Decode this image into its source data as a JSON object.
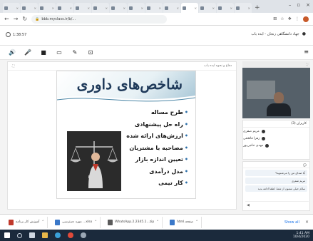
{
  "browser": {
    "tabs": [
      {
        "title": "",
        "active": false
      },
      {
        "title": "",
        "active": false
      },
      {
        "title": "",
        "active": false
      },
      {
        "title": "",
        "active": false
      },
      {
        "title": "",
        "active": false
      },
      {
        "title": "",
        "active": false
      },
      {
        "title": "",
        "active": false
      },
      {
        "title": "",
        "active": false
      },
      {
        "title": "",
        "active": false
      },
      {
        "title": "",
        "active": false
      },
      {
        "title": "",
        "active": true
      },
      {
        "title": "",
        "active": false
      },
      {
        "title": "",
        "active": false
      },
      {
        "title": "",
        "active": false
      }
    ],
    "new_tab": "+",
    "url": "bbb.myclass.ir/b/..."
  },
  "app": {
    "elapsed_time": "1:38:57",
    "class_name": "جهاد دانشگاهی زنجان - ایده یاب"
  },
  "content_header": {
    "left": "",
    "right": "دفاع و نحوه ایده یاب"
  },
  "slide": {
    "title": "شاخص‌های داوری",
    "bullets": [
      "طرح مساله",
      "راه حل پیشنهادی",
      "ارزش‌های ارائه شده",
      "مصاحبه با مشتریان",
      "تعیین اندازه بازار",
      "مدل درآمدی",
      "کار تیمی"
    ]
  },
  "participants": {
    "header": "کاربران (3)",
    "items": [
      {
        "name": "مریم صفری"
      },
      {
        "name": "زهرا قاسمی"
      },
      {
        "name": "مهدی حاجی‌پور"
      }
    ]
  },
  "chat": {
    "messages": [
      {
        "text": "آیا صدای من را می‌شنوید؟"
      },
      {
        "text": "مریم صفری"
      },
      {
        "text": "سلام خیلی ممنون از شما. لطفا ادامه بدید"
      }
    ]
  },
  "downloads": [
    {
      "name": "آموزش کار برنامه"
    },
    {
      "name": "مورد دسترسی ...xlsx"
    },
    {
      "name": "WhatsApp.2.2345.1...zip"
    },
    {
      "name": "html.صفحه"
    }
  ],
  "downloads_show_all": "Show all",
  "taskbar": {
    "time": "1:41 AM",
    "date": "10/4/2020"
  }
}
